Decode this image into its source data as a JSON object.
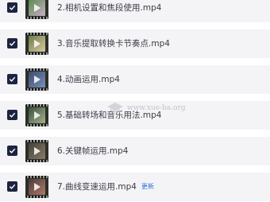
{
  "playlist": {
    "items": [
      {
        "title": "2.相机设置和焦段使用.mp4",
        "checked": true,
        "badge": "",
        "thumb_colors": [
          "#5a8a4c",
          "#c9b0c9"
        ]
      },
      {
        "title": "3.音乐提取转换卡节奏点.mp4",
        "checked": true,
        "badge": "",
        "thumb_colors": [
          "#6d7b4a",
          "#d8c9a0"
        ]
      },
      {
        "title": "4.动画运用.mp4",
        "checked": true,
        "badge": "",
        "thumb_colors": [
          "#3c4a6e",
          "#7b8fb8"
        ]
      },
      {
        "title": "5.基础转场和音乐用法.mp4",
        "checked": true,
        "badge": "",
        "thumb_colors": [
          "#3a4f3a",
          "#a7b090"
        ]
      },
      {
        "title": "6.关键帧运用.mp4",
        "checked": true,
        "badge": "",
        "thumb_colors": [
          "#44423a",
          "#8a7a68"
        ]
      },
      {
        "title": "7.曲线变速运用.mp4",
        "checked": true,
        "badge": "更新",
        "thumb_colors": [
          "#4a3a3a",
          "#b07a6a"
        ]
      }
    ]
  },
  "watermark": {
    "text": "www.xue-ba.org"
  },
  "colors": {
    "row_bg": "#f4f4f6",
    "checkbox": "#1c2440",
    "badge": "#2a6fd6",
    "text": "#3a3d46"
  }
}
